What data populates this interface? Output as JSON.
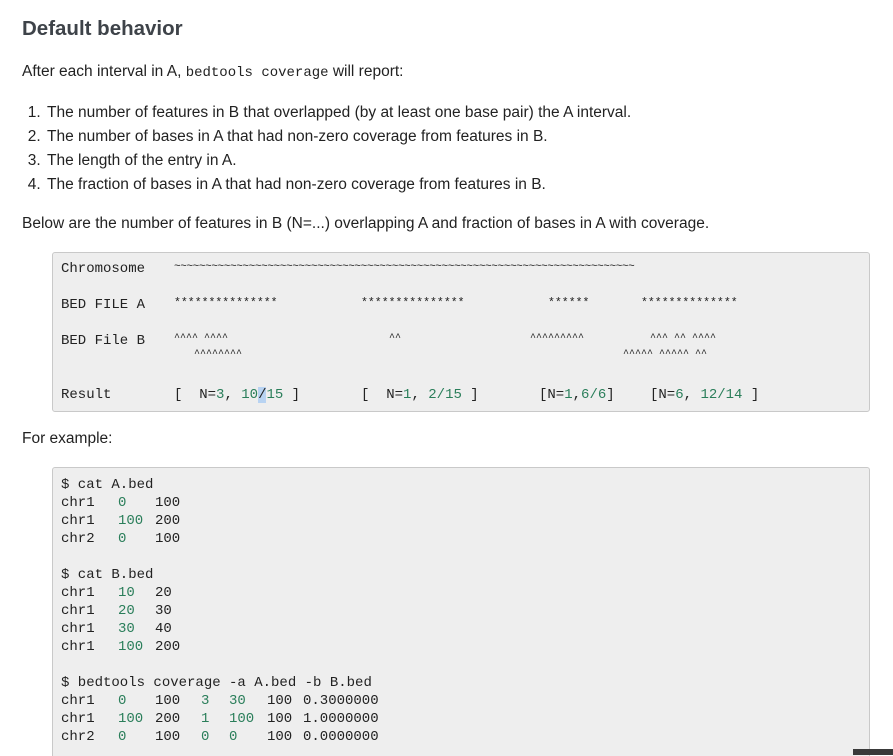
{
  "heading": "Default behavior",
  "intro": {
    "before": "After each interval in A, ",
    "code": "bedtools coverage",
    "after": " will report:"
  },
  "list": [
    "The number of features in B that overlapped (by at least one base pair) the A interval.",
    "The number of bases in A that had non-zero coverage from features in B.",
    "The length of the entry in A.",
    "The fraction of bases in A that had non-zero coverage from features in B."
  ],
  "below_text": "Below are the number of features in B (N=...) overlapping A and fraction of bases in A with coverage.",
  "diagram": {
    "chrom_label": "Chromosome",
    "chrom_line": "~~~~~~~~~~~~~~~~~~~~~~~~~~~~~~~~~~~~~~~~~~~~~~~~~~~~~~~~~~~~~~~~~~~~~~~~~~",
    "bed_a_label": "BED FILE A",
    "bed_a_segments": [
      "***************",
      "***************",
      "******",
      "**************"
    ],
    "bed_b_label": "BED File B",
    "bed_b_row1": [
      "^^^^ ^^^^",
      "^^",
      "^^^^^^^^^",
      "^^^ ^^ ^^^^"
    ],
    "bed_b_row2": [
      "^^^^^^^^",
      "^^^^^ ^^^^^ ^^"
    ],
    "result_label": "Result",
    "results": [
      {
        "open": "[  ",
        "n_label": "N=",
        "n": "3",
        "sep": ", ",
        "frac_num": "10",
        "frac_mid": "/",
        "frac_den": "15",
        "close": " ]"
      },
      {
        "open": "[  ",
        "n_label": "N=",
        "n": "1",
        "sep": ", ",
        "frac_num": "2",
        "frac_mid": "/",
        "frac_den": "15",
        "close": " ]"
      },
      {
        "open": "[",
        "n_label": "N=",
        "n": "1",
        "sep": ",",
        "frac_num": "6",
        "frac_mid": "/",
        "frac_den": "6",
        "close": "]"
      },
      {
        "open": "[",
        "n_label": "N=",
        "n": "6",
        "sep": ", ",
        "frac_num": "12",
        "frac_mid": "/",
        "frac_den": "14",
        "close": " ]"
      }
    ]
  },
  "for_example": "For example:",
  "example": {
    "cmd1": "$ cat A.bed",
    "a_rows": [
      [
        "chr1",
        "0",
        "100"
      ],
      [
        "chr1",
        "100",
        "200"
      ],
      [
        "chr2",
        "0",
        "100"
      ]
    ],
    "cmd2": "$ cat B.bed",
    "b_rows": [
      [
        "chr1",
        "10",
        "20"
      ],
      [
        "chr1",
        "20",
        "30"
      ],
      [
        "chr1",
        "30",
        "40"
      ],
      [
        "chr1",
        "100",
        "200"
      ]
    ],
    "cmd3": "$ bedtools coverage -a A.bed -b B.bed",
    "out_rows": [
      [
        "chr1",
        "0",
        "100",
        "3",
        "30",
        "100",
        "0.3000000"
      ],
      [
        "chr1",
        "100",
        "200",
        "1",
        "100",
        "100",
        "1.0000000"
      ],
      [
        "chr2",
        "0",
        "100",
        "0",
        "0",
        "100",
        "0.0000000"
      ]
    ]
  },
  "colors": {
    "number": "#2a7e5a",
    "heading": "#3e4349",
    "code_bg": "#eeeeee",
    "selection": "#b8d3f2"
  }
}
